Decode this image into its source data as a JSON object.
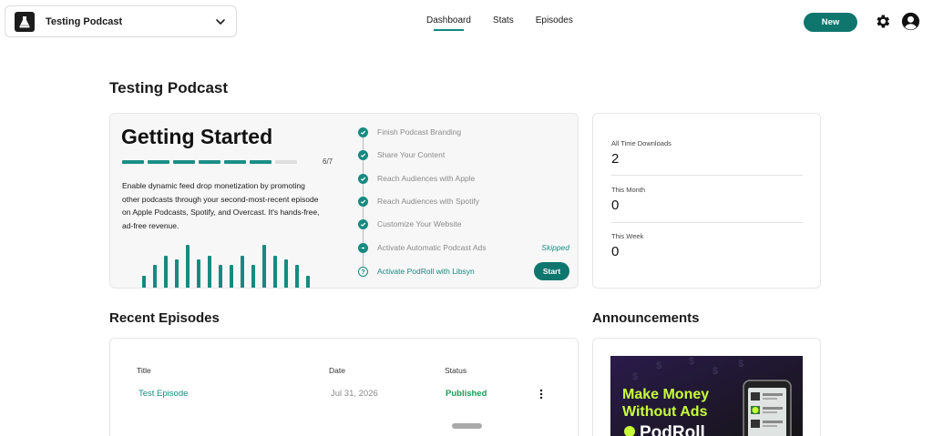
{
  "header": {
    "podcast_name": "Testing Podcast",
    "nav": [
      {
        "label": "Dashboard",
        "active": true
      },
      {
        "label": "Stats",
        "active": false
      },
      {
        "label": "Episodes",
        "active": false
      }
    ],
    "new_button": "New",
    "icons": [
      "flask-logo-icon",
      "chevron-down-icon",
      "gear-icon",
      "account-circle-icon"
    ],
    "accent_color": "#0f766e"
  },
  "page_title": "Testing Podcast",
  "getting_started": {
    "title": "Getting Started",
    "progress_completed": 6,
    "progress_total": 7,
    "progress_label": "6/7",
    "description": "Enable dynamic feed drop monetization by promoting other podcasts through your second-most-recent episode on Apple Podcasts, Spotify, and Overcast. It's hands-free, ad-free revenue.",
    "steps": [
      {
        "label": "Finish Podcast Branding",
        "status": "done"
      },
      {
        "label": "Share Your Content",
        "status": "done"
      },
      {
        "label": "Reach Audiences with Apple",
        "status": "done"
      },
      {
        "label": "Reach Audiences with Spotify",
        "status": "done"
      },
      {
        "label": "Customize Your Website",
        "status": "done"
      },
      {
        "label": "Activate Automatic Podcast Ads",
        "status": "skipped",
        "note": "Skipped"
      },
      {
        "label": "Activate PodRoll with Libsyn",
        "status": "current",
        "action": "Start"
      }
    ]
  },
  "stats": [
    {
      "label": "All Time Downloads",
      "value": "2"
    },
    {
      "label": "This Month",
      "value": "0"
    },
    {
      "label": "This Week",
      "value": "0"
    }
  ],
  "recent_episodes": {
    "heading": "Recent Episodes",
    "columns": [
      "Title",
      "Date",
      "Status"
    ],
    "rows": [
      {
        "title": "Test Episode",
        "date": "Jul 31, 2026",
        "status": "Published"
      }
    ]
  },
  "announcements": {
    "heading": "Announcements",
    "banner_line1": "Make Money",
    "banner_line2": "Without Ads",
    "banner_brand": "PodRoll"
  }
}
